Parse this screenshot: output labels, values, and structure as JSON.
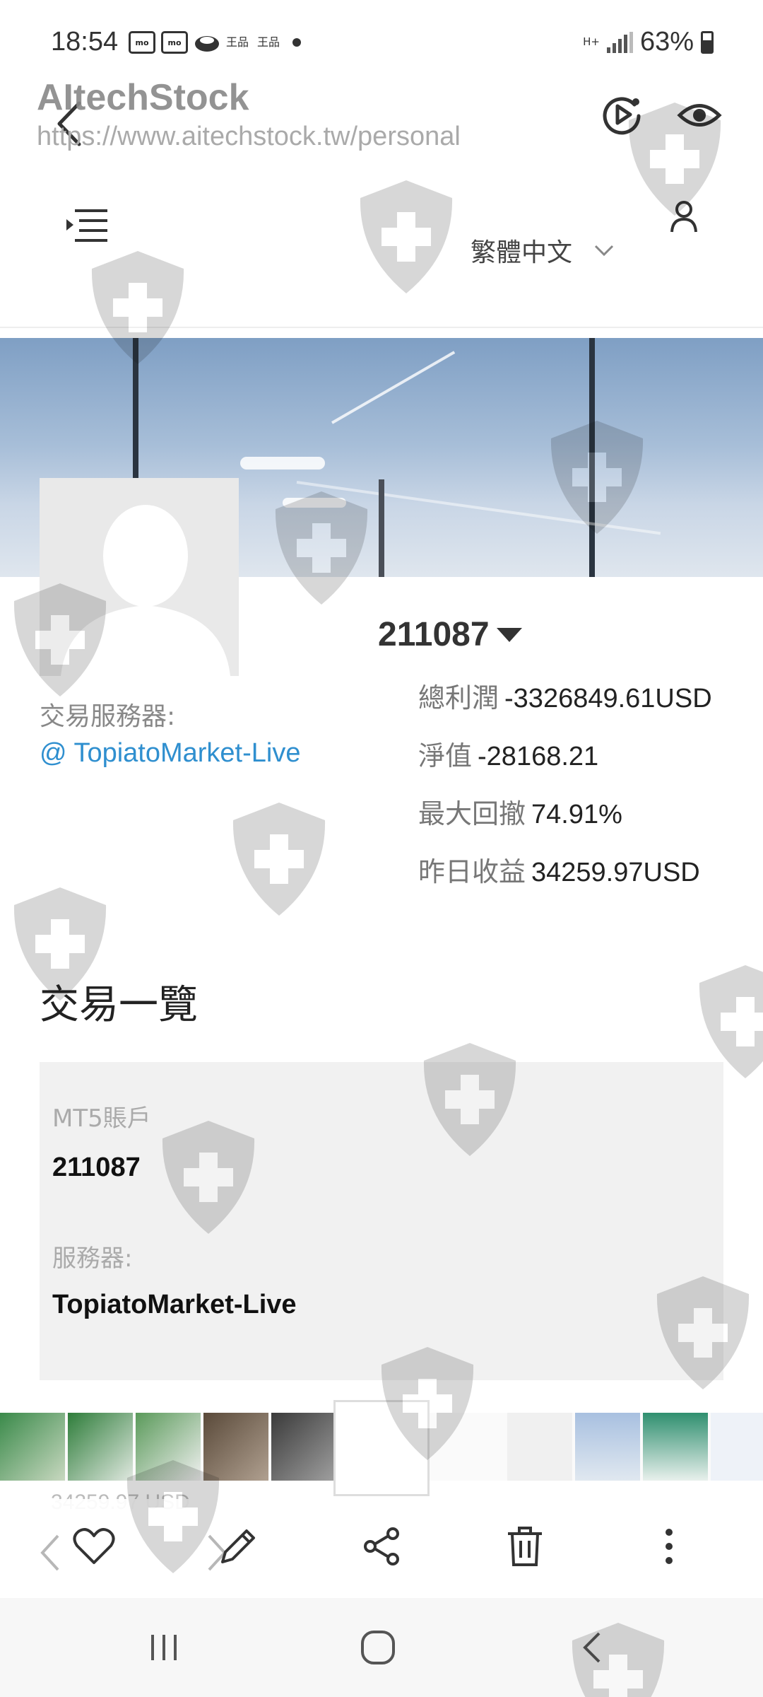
{
  "status_bar": {
    "time": "18:54",
    "notifications": [
      "mo",
      "mo",
      "王品",
      "王品"
    ],
    "network": "H+",
    "battery": "63%"
  },
  "browser": {
    "site_title": "AItechStock",
    "url": "https://www.aitechstock.tw/personal",
    "icons": [
      "back-arrow-icon",
      "video-icon",
      "eye-icon"
    ]
  },
  "header": {
    "language": "繁體中文",
    "icons": [
      "menu-icon",
      "user-icon",
      "chevron-down-icon"
    ]
  },
  "profile": {
    "account_id": "211087",
    "server_label": "交易服務器:",
    "server_link": "@ TopiatoMarket-Live",
    "stats": [
      {
        "label": "總利潤",
        "value": "-3326849.61USD"
      },
      {
        "label": "淨值",
        "value": "-28168.21"
      },
      {
        "label": "最大回撤",
        "value": "74.91%"
      },
      {
        "label": "昨日收益",
        "value": "34259.97USD"
      }
    ]
  },
  "trades": {
    "title": "交易一覽",
    "card": {
      "account_label": "MT5賬戶",
      "account_value": "211087",
      "server_label": "服務器:",
      "server_value": "TopiatoMarket-Live"
    },
    "peek_text": "34259.97 USD"
  },
  "toolbar": {
    "icons": [
      "heart-icon",
      "edit-icon",
      "share-icon",
      "trash-icon",
      "more-icon"
    ]
  },
  "navbar": {
    "icons": [
      "recents-icon",
      "home-icon",
      "back-icon"
    ]
  },
  "colors": {
    "link": "#2f8fcf",
    "card_bg": "#f1f1f1",
    "watermark": "#9a9a9a"
  }
}
